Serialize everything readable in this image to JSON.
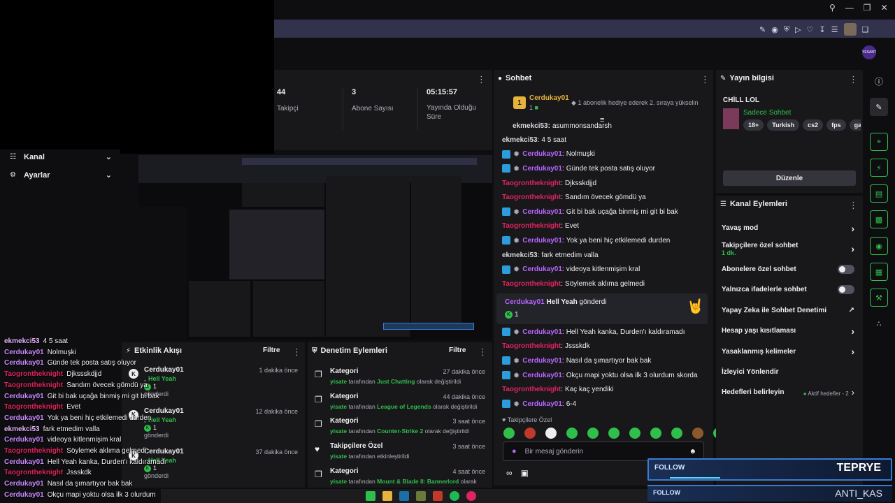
{
  "browser": {
    "topbar_icons": [
      "search-icon",
      "minimize-icon",
      "restore-icon",
      "close-icon"
    ],
    "toolbar_icons": [
      "edit-icon",
      "camera-icon",
      "shield-icon",
      "play-icon",
      "heart-icon",
      "download-icon",
      "menu-icon",
      "avatar",
      "extension-icon"
    ]
  },
  "header": {
    "avatar_label": "YESANT"
  },
  "stats": [
    {
      "value": "44",
      "label": "Takipçi"
    },
    {
      "value": "3",
      "label": "Abone Sayısı"
    },
    {
      "value": "05:15:57",
      "label": "Yayında Olduğu Süre"
    }
  ],
  "sidebar": {
    "items": [
      {
        "label": "Kanal"
      },
      {
        "label": "Ayarlar"
      }
    ]
  },
  "chat": {
    "title": "Sohbet",
    "top_user": "Cerdukay01",
    "top_count": "1",
    "top_rank": "1",
    "sub_note": "1 abonelik hediye ederek 2. sıraya yükselin",
    "partial_line": {
      "user": "ekmekci53:",
      "text": "asummonsandarsh"
    },
    "messages": [
      {
        "user": "ekmekci53",
        "text": "4 5 saat",
        "color": "#d8d8de",
        "badges": false
      },
      {
        "user": "Cerdukay01",
        "text": "Nolmuşki",
        "color": "#b865ff",
        "badges": true
      },
      {
        "user": "Cerdukay01",
        "text": "Günde tek posta satış oluyor",
        "color": "#b865ff",
        "badges": true
      },
      {
        "user": "Taogrontheknight",
        "text": "Djksskdjjd",
        "color": "#e0245e",
        "badges": false
      },
      {
        "user": "Taogrontheknight",
        "text": "Sandım övecek gömdü ya",
        "color": "#e0245e",
        "badges": false
      },
      {
        "user": "Cerdukay01",
        "text": "Git bi bak uçağa binmiş mi git bi bak",
        "color": "#b865ff",
        "badges": true
      },
      {
        "user": "Taogrontheknight",
        "text": "Evet",
        "color": "#e0245e",
        "badges": false
      },
      {
        "user": "Cerdukay01",
        "text": "Yok ya beni hiç etkilemedi durden",
        "color": "#b865ff",
        "badges": true
      },
      {
        "user": "ekmekci53",
        "text": "fark etmedim valla",
        "color": "#d8d8de",
        "badges": false
      },
      {
        "user": "Cerdukay01",
        "text": "videoya kitlenmişim kral",
        "color": "#b865ff",
        "badges": true
      },
      {
        "user": "Taogrontheknight",
        "text": "Söylemek aklıma gelmedi",
        "color": "#e0245e",
        "badges": false
      }
    ],
    "gift": {
      "user": "Cerdukay01",
      "item": "Hell Yeah",
      "verb": "gönderdi",
      "count": "1"
    },
    "messages2": [
      {
        "user": "Cerdukay01",
        "text": "Hell Yeah kanka, Durden'ı kaldıramadı",
        "color": "#b865ff",
        "badges": true
      },
      {
        "user": "Taogrontheknight",
        "text": "Jssskdk",
        "color": "#e0245e",
        "badges": false
      },
      {
        "user": "Cerdukay01",
        "text": "Nasıl da şımartıyor bak bak",
        "color": "#b865ff",
        "badges": true
      },
      {
        "user": "Cerdukay01",
        "text": "Okçu mapi yoktu olsa ilk 3 olurdum skorda",
        "color": "#b865ff",
        "badges": true
      },
      {
        "user": "Taogrontheknight",
        "text": "Kaç kaç yendiki",
        "color": "#e0245e",
        "badges": false
      },
      {
        "user": "Cerdukay01",
        "text": "6-4",
        "color": "#b865ff",
        "badges": true
      }
    ],
    "followers_only": "Takipçilere Özel",
    "input_placeholder": "Bir mesaj gönderin"
  },
  "stream_info": {
    "title": "Yayın bilgisi",
    "stream_title": "CHİLL LOL",
    "category": "Sadece Sohbet",
    "tags": [
      "18+",
      "Turkish",
      "cs2",
      "fps",
      "gamin"
    ],
    "edit_button": "Düzenle"
  },
  "channel_actions": {
    "title": "Kanal Eylemleri",
    "items": [
      {
        "label": "Yavaş mod",
        "type": "chevron",
        "sub": ""
      },
      {
        "label": "Takipçilere özel sohbet",
        "type": "chevron",
        "sub": "1 dk."
      },
      {
        "label": "Abonelere özel sohbet",
        "type": "toggle",
        "sub": ""
      },
      {
        "label": "Yalnızca ifadelerle sohbet",
        "type": "toggle",
        "sub": ""
      },
      {
        "label": "Yapay Zeka ile Sohbet Denetimi",
        "type": "external",
        "sub": ""
      },
      {
        "label": "Hesap yaşı kısıtlaması",
        "type": "chevron",
        "sub": ""
      },
      {
        "label": "Yasaklanmış kelimeler",
        "type": "chevron",
        "sub": ""
      },
      {
        "label": "İzleyici Yönlendir",
        "type": "none",
        "sub": ""
      },
      {
        "label": "Hedefleri belirleyin",
        "type": "goal",
        "sub": "Aktif hedefler - 2"
      }
    ]
  },
  "activity": {
    "title": "Etkinlik Akışı",
    "filter": "Filtre",
    "items": [
      {
        "user": "Cerdukay01",
        "time": "1 dakika önce",
        "item": "Hell Yeah",
        "count": "1",
        "verb": "gönderdi"
      },
      {
        "user": "Cerdukay01",
        "time": "12 dakika önce",
        "item": "Hell Yeah",
        "count": "1",
        "verb": "gönderdi"
      },
      {
        "user": "Cerdukay01",
        "time": "37 dakika önce",
        "item": "Hell Yeah",
        "count": "1",
        "verb": "gönderdi"
      }
    ]
  },
  "moderation": {
    "title": "Denetim Eylemleri",
    "filter": "Filtre",
    "items": [
      {
        "title": "Kategori",
        "time": "27 dakika önce",
        "user": "yisate",
        "pre": "tarafından",
        "value": "Just Chatting",
        "post": "olarak değiştirildi",
        "icon": "category-icon"
      },
      {
        "title": "Kategori",
        "time": "44 dakika önce",
        "user": "yisate",
        "pre": "tarafından",
        "value": "League of Legends",
        "post": "olarak değiştirildi",
        "icon": "category-icon"
      },
      {
        "title": "Kategori",
        "time": "3 saat önce",
        "user": "yisate",
        "pre": "tarafından",
        "value": "Counter-Strike 2",
        "post": "olarak değiştirildi",
        "icon": "category-icon"
      },
      {
        "title": "Takipçilere Özel",
        "time": "3 saat önce",
        "user": "yisate",
        "pre": "tarafından etkinleştirildi",
        "value": "",
        "post": "",
        "icon": "heart-icon"
      },
      {
        "title": "Kategori",
        "time": "4 saat önce",
        "user": "yisate",
        "pre": "tarafından",
        "value": "Mount & Blade II: Bannerlord",
        "post": "olarak",
        "icon": "category-icon"
      }
    ]
  },
  "overlay_chat": [
    {
      "user": "ekmekci53",
      "text": "4 5 saat",
      "color": "#e6b3ff"
    },
    {
      "user": "Cerdukay01",
      "text": "Nolmuşki",
      "color": "#c98bff"
    },
    {
      "user": "Cerdukay01",
      "text": "Günde tek posta satış oluyor",
      "color": "#c98bff"
    },
    {
      "user": "Taogrontheknight",
      "text": "Djkssskdjjd",
      "color": "#e0245e"
    },
    {
      "user": "Taogrontheknight",
      "text": "Sandım övecek gömdü ya",
      "color": "#e0245e"
    },
    {
      "user": "Cerdukay01",
      "text": "Git bi bak uçağa binmiş mi git bi bak",
      "color": "#c98bff"
    },
    {
      "user": "Taogrontheknight",
      "text": "Evet",
      "color": "#e0245e"
    },
    {
      "user": "Cerdukay01",
      "text": "Yok ya beni hiç etkilemedi durden",
      "color": "#c98bff"
    },
    {
      "user": "ekmekci53",
      "text": "fark etmedim valla",
      "color": "#e6b3ff"
    },
    {
      "user": "Cerdukay01",
      "text": "videoya kitlenmişim kral",
      "color": "#c98bff"
    },
    {
      "user": "Taogrontheknight",
      "text": "Söylemek aklıma gelmedi",
      "color": "#e0245e"
    },
    {
      "user": "Cerdukay01",
      "text": "Hell Yeah kanka, Durden'ı kaldıramadı",
      "color": "#c98bff"
    },
    {
      "user": "Taogrontheknight",
      "text": "Jssskdk",
      "color": "#e0245e"
    },
    {
      "user": "Cerdukay01",
      "text": "Nasıl da şımartıyor bak bak",
      "color": "#c98bff"
    },
    {
      "user": "Cerdukay01",
      "text": "Okçu mapi yoktu olsa ilk 3 olurdum",
      "color": "#c98bff"
    }
  ],
  "follow_alerts": [
    {
      "label": "FOLLOW",
      "name": "TEPRYE",
      "progress": 0.6
    },
    {
      "label": "FOLLOW",
      "name": "ANTI_KAS",
      "progress": 0.0
    }
  ],
  "taskbar": {
    "icons": [
      "windows-icon",
      "file-explorer-icon",
      "steam-icon",
      "app-icon",
      "media-icon",
      "spotify-icon",
      "recorder-icon"
    ]
  },
  "right_rail": {
    "icons": [
      "info-icon",
      "pen-icon",
      "crosshair-icon",
      "bolt-icon",
      "document-icon",
      "chat-bubble-icon",
      "broadcast-icon",
      "layout-icon",
      "wrench-icon",
      "drops-icon"
    ]
  },
  "colors": {
    "accent": "#2fbf4a",
    "mod_badge": "#2d9cdb",
    "bg": "#0e0e10",
    "panel": "#18181b"
  }
}
